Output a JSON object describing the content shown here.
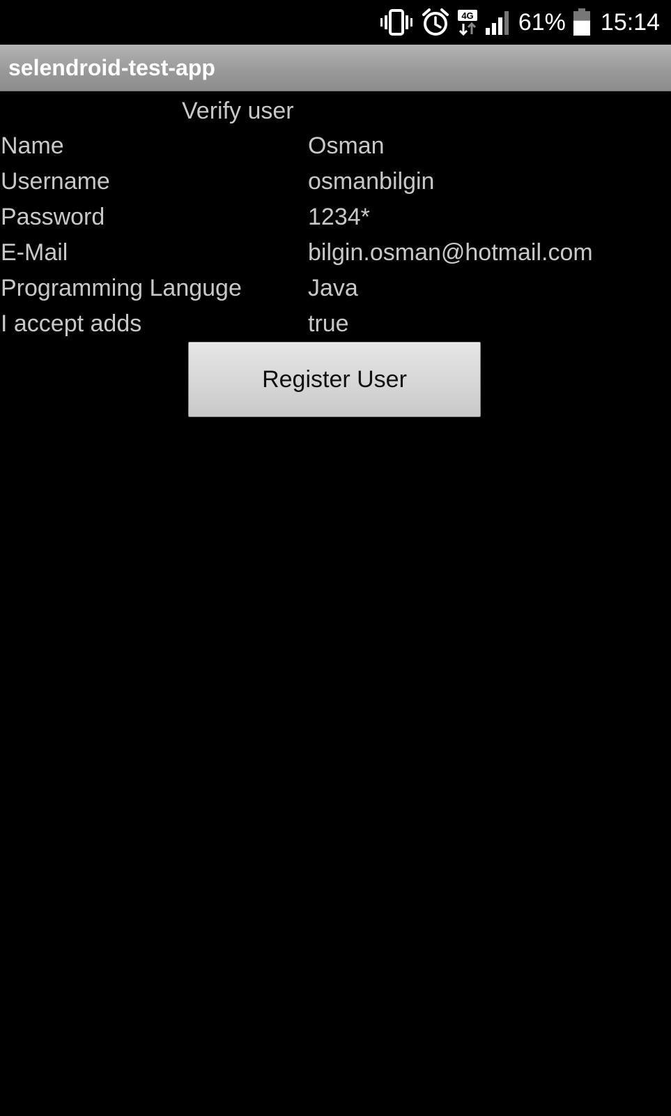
{
  "status_bar": {
    "battery_percent": "61%",
    "battery_level": 0.61,
    "time": "15:14",
    "network_type": "4G",
    "icons": [
      "vibrate-icon",
      "alarm-icon",
      "network-4g-icon",
      "signal-icon",
      "battery-icon"
    ]
  },
  "app": {
    "title": "selendroid-test-app"
  },
  "screen": {
    "heading": "Verify user",
    "fields": [
      {
        "label": "Name",
        "value": "Osman"
      },
      {
        "label": "Username",
        "value": "osmanbilgin"
      },
      {
        "label": "Password",
        "value": "1234*"
      },
      {
        "label": "E-Mail",
        "value": "bilgin.osman@hotmail.com"
      },
      {
        "label": "Programming Languge",
        "value": "Java"
      },
      {
        "label": "I accept adds",
        "value": "true"
      }
    ],
    "register_button_label": "Register User"
  },
  "colors": {
    "background": "#000000",
    "text": "#c8c8c8",
    "title_bar": "#9a9a9a",
    "button": "#d8d8d8"
  }
}
